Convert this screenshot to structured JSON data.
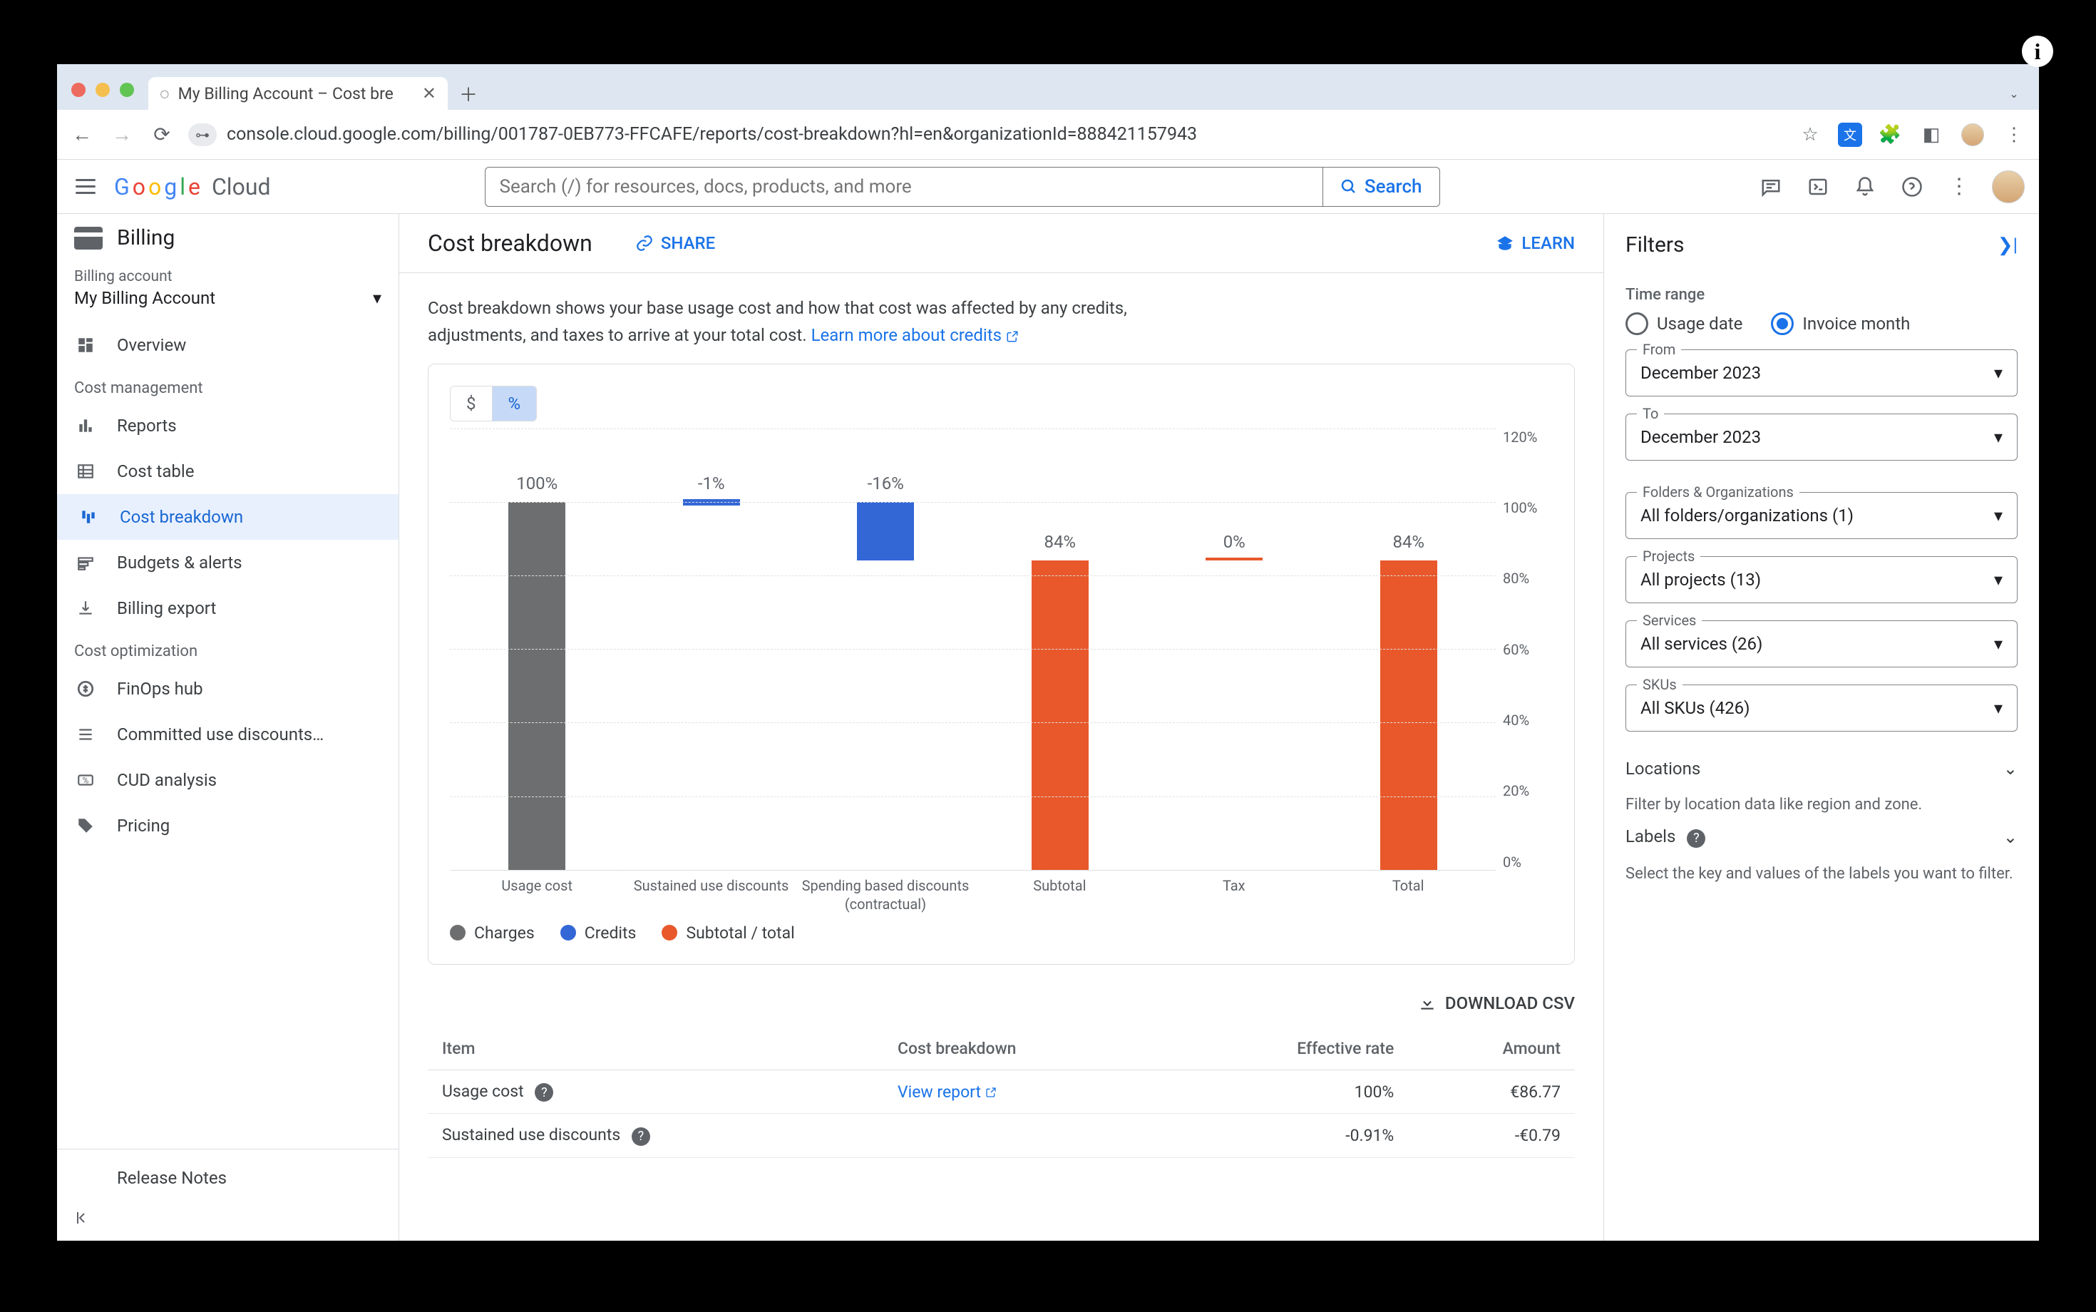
{
  "info_badge": "i",
  "browser": {
    "tab_title": "My Billing Account – Cost bre",
    "url": "console.cloud.google.com/billing/001787-0EB773-FFCAFE/reports/cost-breakdown?hl=en&organizationId=888421157943"
  },
  "header": {
    "logo_text": "Google Cloud",
    "search_placeholder": "Search (/) for resources, docs, products, and more",
    "search_btn": "Search"
  },
  "sidebar": {
    "title": "Billing",
    "acct_label": "Billing account",
    "acct_value": "My Billing Account",
    "overview": "Overview",
    "section_cost_mgmt": "Cost management",
    "reports": "Reports",
    "cost_table": "Cost table",
    "cost_breakdown": "Cost breakdown",
    "budgets": "Budgets & alerts",
    "billing_export": "Billing export",
    "section_cost_opt": "Cost optimization",
    "finops": "FinOps hub",
    "cud": "Committed use discounts…",
    "cud_analysis": "CUD analysis",
    "pricing": "Pricing",
    "release_notes": "Release Notes"
  },
  "page": {
    "title": "Cost breakdown",
    "share": "SHARE",
    "learn": "LEARN",
    "desc_a": "Cost breakdown shows your base usage cost and how that cost was affected by any credits, adjustments, and taxes to arrive at your total cost. ",
    "desc_link": "Learn more about credits",
    "toggle_dollar": "$",
    "toggle_pct": "%",
    "download": "DOWNLOAD CSV"
  },
  "chart_data": {
    "type": "bar",
    "title": "",
    "xlabel": "",
    "ylabel": "",
    "ylim": [
      0,
      120
    ],
    "y_ticks": [
      "120%",
      "100%",
      "80%",
      "60%",
      "40%",
      "20%",
      "0%"
    ],
    "categories": [
      "Usage cost",
      "Sustained use discounts",
      "Spending based discounts (contractual)",
      "Subtotal",
      "Tax",
      "Total"
    ],
    "series": [
      {
        "name": "Charges",
        "color": "#6d6e6f",
        "bars": [
          {
            "cat": 0,
            "from": 0,
            "to": 100,
            "label": "100%"
          }
        ]
      },
      {
        "name": "Credits",
        "color": "#3367d6",
        "bars": [
          {
            "cat": 1,
            "from": 99,
            "to": 100,
            "label": "-1%"
          },
          {
            "cat": 2,
            "from": 84,
            "to": 100,
            "label": "-16%"
          }
        ]
      },
      {
        "name": "Subtotal / total",
        "color": "#e8582b",
        "bars": [
          {
            "cat": 3,
            "from": 0,
            "to": 84,
            "label": "84%"
          },
          {
            "cat": 4,
            "from": 84,
            "to": 84,
            "label": "0%"
          },
          {
            "cat": 5,
            "from": 0,
            "to": 84,
            "label": "84%"
          }
        ]
      }
    ],
    "legend": [
      "Charges",
      "Credits",
      "Subtotal / total"
    ]
  },
  "table": {
    "cols": [
      "Item",
      "Cost breakdown",
      "Effective rate",
      "Amount"
    ],
    "rows": [
      {
        "item": "Usage cost",
        "help": true,
        "breakdown_link": "View report",
        "rate": "100%",
        "amount": "€86.77"
      },
      {
        "item": "Sustained use discounts",
        "help": true,
        "breakdown_link": "",
        "rate": "-0.91%",
        "amount": "-€0.79"
      }
    ]
  },
  "filters": {
    "title": "Filters",
    "time_range": "Time range",
    "radio_usage": "Usage date",
    "radio_invoice": "Invoice month",
    "from_label": "From",
    "from_value": "December 2023",
    "to_label": "To",
    "to_value": "December 2023",
    "folders_label": "Folders & Organizations",
    "folders_value": "All folders/organizations (1)",
    "projects_label": "Projects",
    "projects_value": "All projects (13)",
    "services_label": "Services",
    "services_value": "All services (26)",
    "skus_label": "SKUs",
    "skus_value": "All SKUs (426)",
    "locations": "Locations",
    "locations_hint": "Filter by location data like region and zone.",
    "labels": "Labels",
    "labels_hint": "Select the key and values of the labels you want to filter."
  }
}
